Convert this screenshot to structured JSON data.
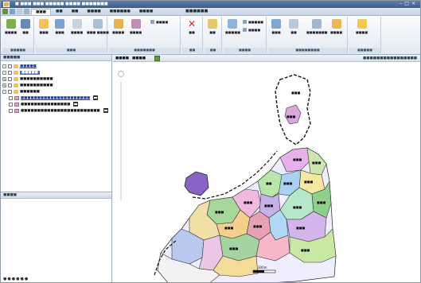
{
  "window": {
    "title": "■ ■■■ ■■■ ■■■■■ ■■■■ ■■■■■■■"
  },
  "ribbon_tabs": [
    {
      "label": "■■■"
    },
    {
      "label": "■■"
    },
    {
      "label": "■■"
    },
    {
      "label": "■■■■"
    },
    {
      "label": "■■■■■■"
    },
    {
      "label": "■■■■"
    }
  ],
  "ribbon_context_title": "■■■■■■",
  "ribbon": {
    "groups": [
      {
        "label": "■■■■■",
        "buttons": [
          "■■■■",
          "■■"
        ]
      },
      {
        "label": "■■■",
        "buttons": [
          "■■■",
          "■■■",
          "■■■■",
          "■■■ ■■■■"
        ]
      },
      {
        "label": "■■■■■■■",
        "buttons": [
          "■■■■",
          "■■■■",
          "■■■■"
        ]
      },
      {
        "label": "■■",
        "buttons": [
          "■■"
        ]
      },
      {
        "label": "■■",
        "buttons": [
          "■■"
        ]
      },
      {
        "label": "■■■■",
        "buttons": [
          "■■■■■",
          "■■■■■",
          "■■■■"
        ]
      },
      {
        "label": "■■■■■■■■",
        "buttons": [
          "■■■",
          "■■",
          "■■■■■■■",
          "■■■■"
        ]
      },
      {
        "label": "■■■■■",
        "buttons": [
          "■■■■"
        ]
      }
    ]
  },
  "layer_pane": {
    "header": "■■■■■",
    "items": [
      {
        "label": "■■■■■",
        "link": true
      },
      {
        "label": "■■■■■",
        "selected": true
      },
      {
        "label": "■■■■■■■■■■"
      },
      {
        "label": "■■■■■■■■■■"
      },
      {
        "label": "■■■■■■"
      },
      {
        "label": "■■■■■■■■■■■■■■■■■■■■■",
        "link": true
      },
      {
        "label": "■■■■■■■■■■■■■■■"
      },
      {
        "label": "■■■■■■■■■■■■■■■■■■■■■■■■"
      }
    ]
  },
  "info_pane": {
    "header": "■■■■",
    "status": "●●●●●●"
  },
  "map": {
    "tab_label": "■■■■",
    "tab_value": "■■■■",
    "right_label": "■■■■■■■■■■■■■■■■",
    "scale_label": "300m",
    "district_labels": [
      "■■■",
      "■■■",
      "■■■",
      "■■■",
      "■■",
      "■■■",
      "■■■",
      "■■■",
      "■■■",
      "■■■",
      "■■■",
      "■■■",
      "■■■",
      "■■■",
      "■■■",
      "■■■",
      "■■■"
    ]
  },
  "colors": {
    "ribbon_accent": "#3f6fb2",
    "selection": "#3f6fb2",
    "map_water": "#ffffff"
  }
}
